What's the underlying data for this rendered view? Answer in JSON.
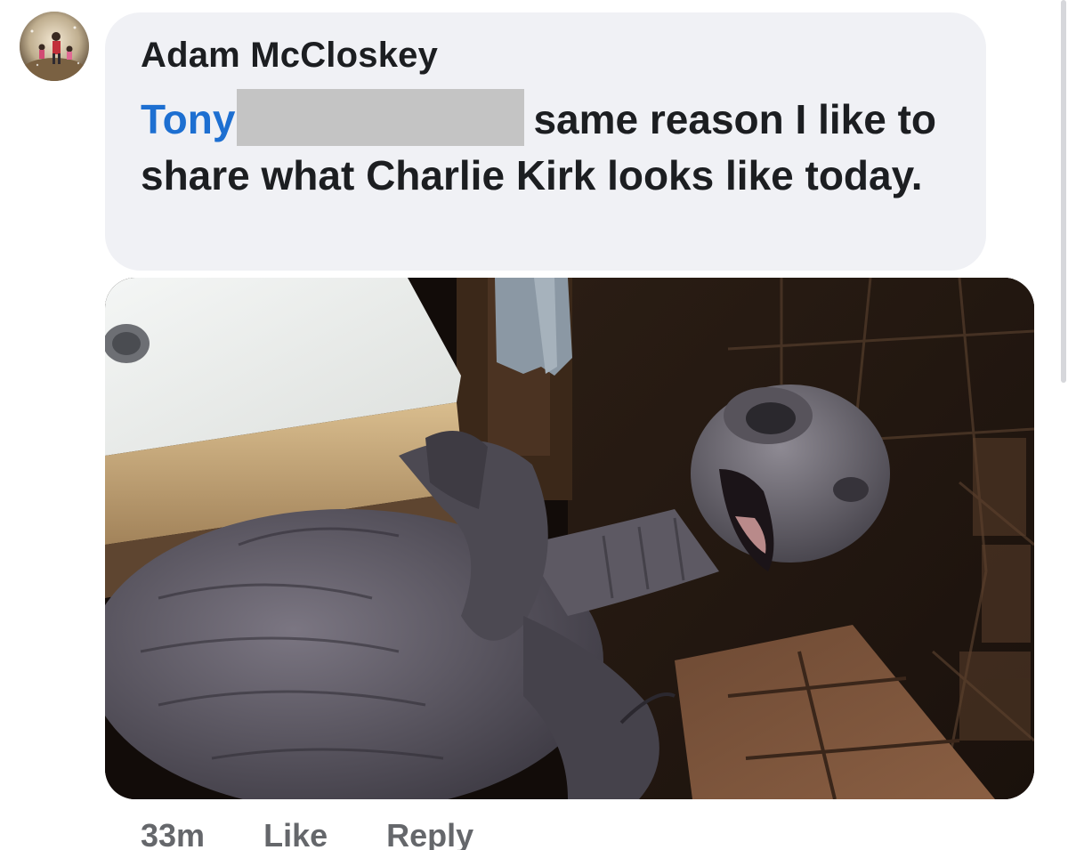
{
  "comment": {
    "author": "Adam McCloskey",
    "mention": "Tony",
    "text": "same reason I like to share what Charlie Kirk looks like today.",
    "time": "33m",
    "like_label": "Like",
    "reply_label": "Reply"
  },
  "icons": {
    "avatar": "profile-photo",
    "attachment": "photo"
  }
}
